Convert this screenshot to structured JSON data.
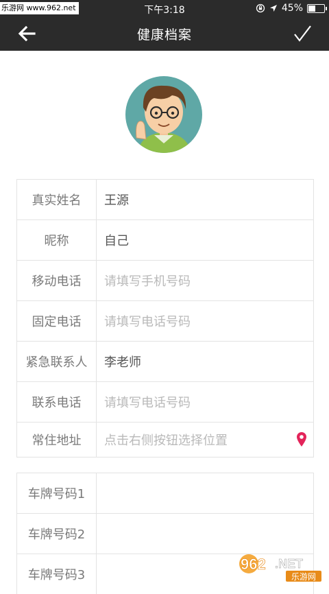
{
  "status_bar": {
    "watermark_text": "乐游网 www.962.net",
    "time": "下午3:18",
    "battery": "45%"
  },
  "navbar": {
    "title": "健康档案",
    "back_icon": "arrow-left-icon",
    "confirm_icon": "check-icon"
  },
  "profile_form": [
    {
      "label": "真实姓名",
      "value": "王源",
      "placeholder": false
    },
    {
      "label": "昵称",
      "value": "自己",
      "placeholder": false
    },
    {
      "label": "移动电话",
      "value": "请填写手机号码",
      "placeholder": true
    },
    {
      "label": "固定电话",
      "value": "请填写电话号码",
      "placeholder": true
    },
    {
      "label": "紧急联系人",
      "value": "李老师",
      "placeholder": false
    },
    {
      "label": "联系电话",
      "value": "请填写电话号码",
      "placeholder": true
    },
    {
      "label": "常住地址",
      "value": "点击右侧按钮选择位置",
      "placeholder": true
    }
  ],
  "vehicle_form": [
    {
      "label": "车牌号码1",
      "value": ""
    },
    {
      "label": "车牌号码2",
      "value": ""
    },
    {
      "label": "车牌号码3",
      "value": ""
    }
  ],
  "corner_watermark": {
    "brand": "962",
    "suffix": ".NET",
    "sub": "乐游网"
  },
  "colors": {
    "nav_bg": "#2b2b2b",
    "pin": "#e3245a"
  }
}
